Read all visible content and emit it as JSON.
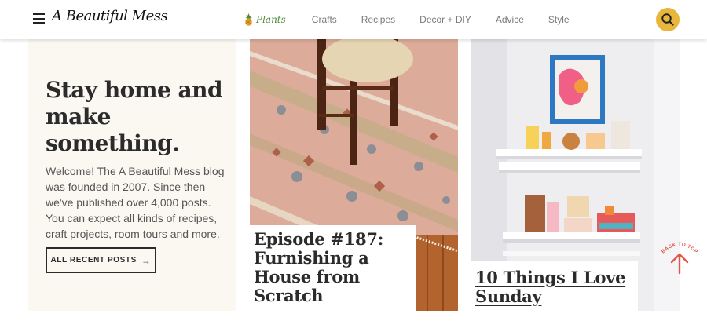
{
  "header": {
    "logo_text": "A Beautiful Mess",
    "menu_icon": "hamburger-icon",
    "nav": {
      "plants_label": "Plants",
      "plants_icon": "pineapple-icon",
      "items": [
        "Crafts",
        "Recipes",
        "Decor + DIY",
        "Advice",
        "Style"
      ]
    },
    "search_icon": "search-icon",
    "accent_color": "#e8b63a"
  },
  "hero": {
    "title": "Stay home and make something.",
    "body": "Welcome! The A Beautiful Mess blog was founded in 2007. Since then we've published over 4,000 posts. You can expect all kinds of recipes, craft projects, room tours and more.",
    "button_label": "ALL RECENT POSTS",
    "button_icon": "arrow-right-icon",
    "background": "#fbf8f2"
  },
  "cards": [
    {
      "title": "Episode #187: Furnishing a House from Scratch",
      "image": "rug-and-chair-photo"
    },
    {
      "title": "10 Things I Love Sunday",
      "image": "wall-shelves-photo"
    }
  ],
  "back_to_top": {
    "label": "BACK TO TOP",
    "icon": "arrow-up-icon",
    "color": "#e0584a"
  }
}
